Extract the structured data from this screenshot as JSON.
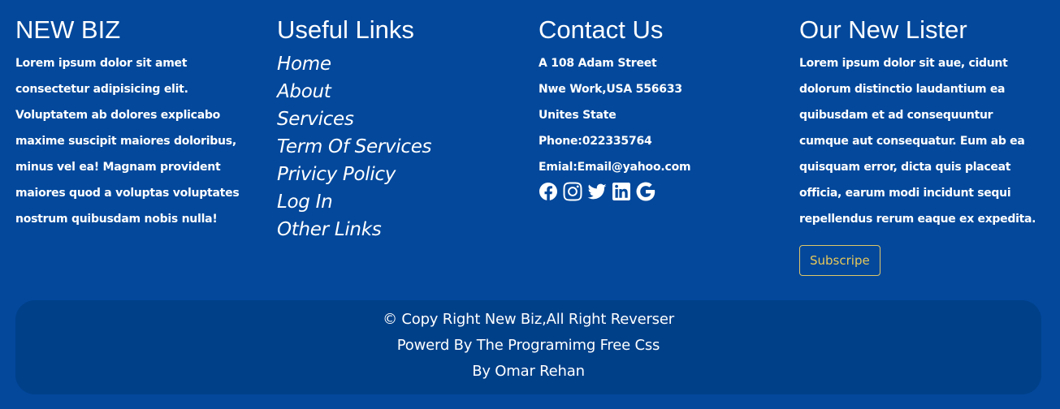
{
  "brand": {
    "title": "NEW BIZ",
    "description": "Lorem ipsum dolor sit amet consectetur adipisicing elit. Voluptatem ab dolores explicabo maxime suscipit maiores doloribus, minus vel ea! Magnam provident maiores quod a voluptas voluptates nostrum quibusdam nobis nulla!"
  },
  "useful_links": {
    "title": "Useful Links",
    "items": [
      {
        "label": "Home"
      },
      {
        "label": "About"
      },
      {
        "label": "Services"
      },
      {
        "label": "Term Of Services"
      },
      {
        "label": "Privicy Policy"
      },
      {
        "label": "Log In"
      },
      {
        "label": "Other Links"
      }
    ]
  },
  "contact": {
    "title": "Contact Us",
    "address_line1": "A 108 Adam Street",
    "address_line2": "Nwe Work,USA 556633",
    "address_line3": "Unites State",
    "phone": "Phone:022335764",
    "email": "Emial:Email@yahoo.com",
    "socials": [
      "facebook-icon",
      "instagram-icon",
      "twitter-icon",
      "linkedin-icon",
      "google-icon"
    ]
  },
  "newsletter": {
    "title": "Our New Lister",
    "description": "Lorem ipsum dolor sit aue, cidunt dolorum distinctio laudantium ea quibusdam et ad consequuntur cumque aut consequatur. Eum ab ea quisquam error, dicta quis placeat officia, earum modi incidunt sequi repellendus rerum eaque ex expedita.",
    "button_label": "Subscripe"
  },
  "copyright": {
    "line1": "© Copy Right New Biz,All Right Reverser",
    "line2": "Powerd By The Programimg Free Css",
    "line3": "By Omar Rehan"
  },
  "colors": {
    "background": "#03489b",
    "copyright_background": "#004089",
    "button_accent": "#e8c85a",
    "text": "#ffffff"
  }
}
